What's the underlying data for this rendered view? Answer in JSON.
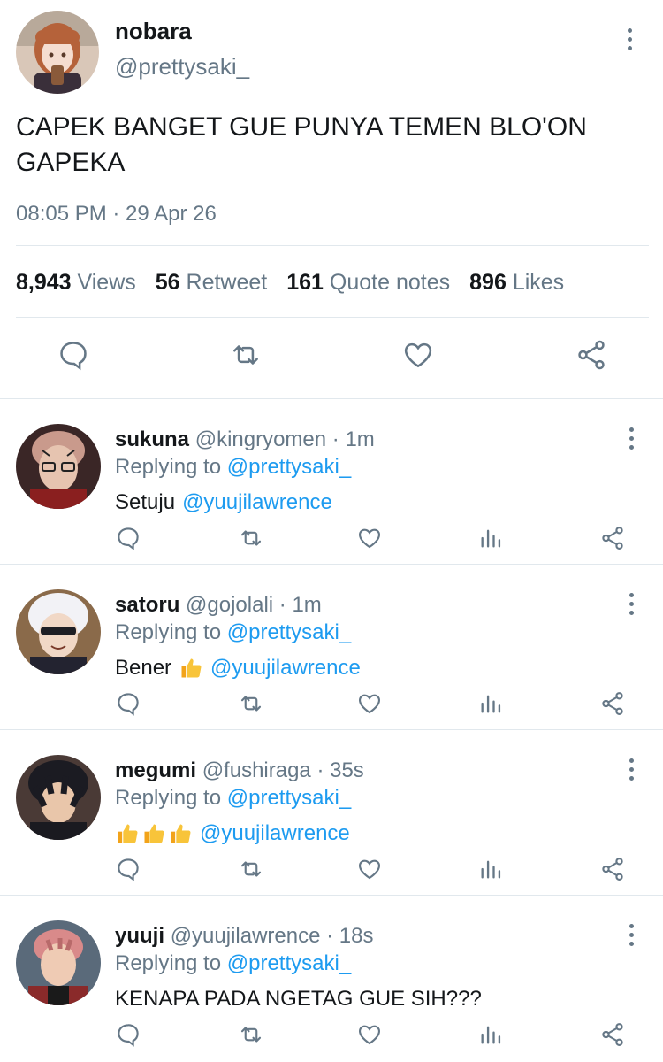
{
  "tweet": {
    "name": "nobara",
    "handle": "@prettysaki_",
    "text": "CAPEK BANGET GUE PUNYA TEMEN BLO'ON GAPEKA",
    "time": "08:05 PM · 29 Apr 26",
    "stats": {
      "views_count": "8,943",
      "views_label": "Views",
      "retweet_count": "56",
      "retweet_label": "Retweet",
      "quote_count": "161",
      "quote_label": "Quote notes",
      "likes_count": "896",
      "likes_label": "Likes"
    }
  },
  "replies": [
    {
      "name": "sukuna",
      "handle": "@kingryomen",
      "time": "· 1m",
      "replying_label": "Replying to",
      "replying_to": "@prettysaki_",
      "text": "Setuju",
      "mention": "@yuujilawrence",
      "thumbs": 0
    },
    {
      "name": "satoru",
      "handle": "@gojolali",
      "time": "· 1m",
      "replying_label": "Replying to",
      "replying_to": "@prettysaki_",
      "text": "Bener",
      "mention": "@yuujilawrence",
      "thumbs": 1
    },
    {
      "name": "megumi",
      "handle": "@fushiraga",
      "time": "· 35s",
      "replying_label": "Replying to",
      "replying_to": "@prettysaki_",
      "text": "",
      "mention": "@yuujilawrence",
      "thumbs": 3
    },
    {
      "name": "yuuji",
      "handle": "@yuujilawrence",
      "time": "· 18s",
      "replying_label": "Replying to",
      "replying_to": "@prettysaki_",
      "text": "KENAPA PADA NGETAG GUE SIH???",
      "mention": "",
      "thumbs": 0
    }
  ],
  "icons": {
    "reply": "comment-bubble-icon",
    "retweet": "retweet-icon",
    "like": "heart-icon",
    "analytics": "analytics-icon",
    "share": "share-icon",
    "more": "more-vertical-icon",
    "thumbs": "thumbs-up-emoji"
  },
  "colors": {
    "accent": "#1d9bf0",
    "secondary_text": "#657786",
    "primary_text": "#14171a",
    "divider": "#e1e8ed"
  }
}
